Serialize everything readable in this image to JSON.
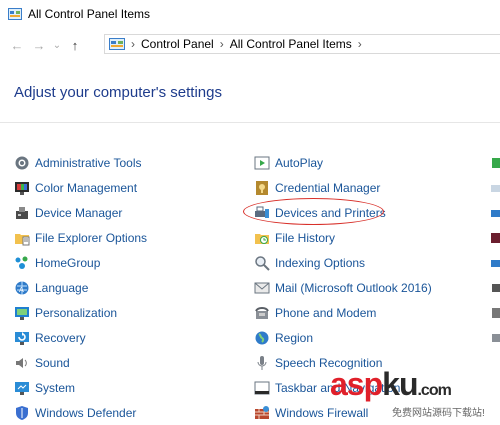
{
  "window": {
    "title": "All Control Panel Items"
  },
  "nav": {
    "back_label": "←",
    "forward_label": "→",
    "recent_label": "⌄",
    "up_label": "↑"
  },
  "address": {
    "sep": "›",
    "crumbs": [
      "Control Panel",
      "All Control Panel Items"
    ]
  },
  "heading": "Adjust your computer's settings",
  "columns": [
    {
      "items": [
        {
          "label": "Administrative Tools",
          "icon": "administrative-tools-icon"
        },
        {
          "label": "Color Management",
          "icon": "color-management-icon"
        },
        {
          "label": "Device Manager",
          "icon": "device-manager-icon"
        },
        {
          "label": "File Explorer Options",
          "icon": "file-explorer-options-icon"
        },
        {
          "label": "HomeGroup",
          "icon": "homegroup-icon"
        },
        {
          "label": "Language",
          "icon": "language-icon"
        },
        {
          "label": "Personalization",
          "icon": "personalization-icon"
        },
        {
          "label": "Recovery",
          "icon": "recovery-icon"
        },
        {
          "label": "Sound",
          "icon": "sound-icon"
        },
        {
          "label": "System",
          "icon": "system-icon"
        },
        {
          "label": "Windows Defender",
          "icon": "windows-defender-icon"
        }
      ]
    },
    {
      "items": [
        {
          "label": "AutoPlay",
          "icon": "autoplay-icon"
        },
        {
          "label": "Credential Manager",
          "icon": "credential-manager-icon"
        },
        {
          "label": "Devices and Printers",
          "icon": "devices-printers-icon"
        },
        {
          "label": "File History",
          "icon": "file-history-icon"
        },
        {
          "label": "Indexing Options",
          "icon": "indexing-options-icon"
        },
        {
          "label": "Mail (Microsoft Outlook 2016)",
          "icon": "mail-icon"
        },
        {
          "label": "Phone and Modem",
          "icon": "phone-modem-icon"
        },
        {
          "label": "Region",
          "icon": "region-icon"
        },
        {
          "label": "Speech Recognition",
          "icon": "speech-recognition-icon"
        },
        {
          "label": "Taskbar and Navigation",
          "icon": "taskbar-icon"
        },
        {
          "label": "Windows Firewall",
          "icon": "windows-firewall-icon"
        }
      ]
    }
  ],
  "watermark": {
    "part1": "asp",
    "part2": "ku",
    "part3": ".com",
    "sub": "免费网站源码下载站!"
  },
  "colors": {
    "link": "#1a5599",
    "heading": "#1e3c8c",
    "annotation": "#d8302a"
  }
}
